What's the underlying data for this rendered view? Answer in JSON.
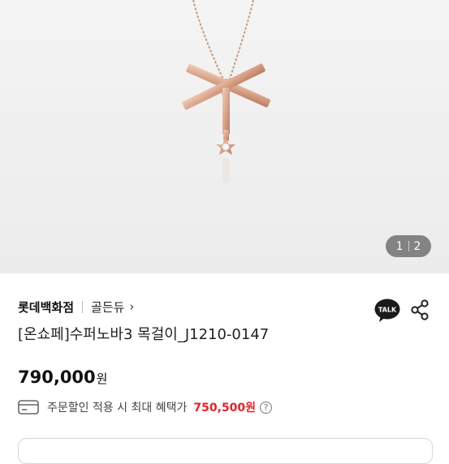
{
  "gallery": {
    "current": "1",
    "total": "2"
  },
  "product": {
    "store": "롯데백화점",
    "brand": "골든듀",
    "brand_chevron": "›",
    "title": "[온쇼페]수퍼노바3 목걸이_J1210-0147",
    "price": "790,000",
    "price_unit": "원"
  },
  "benefit": {
    "label": "주문할인 적용 시 최대 혜택가",
    "price": "750,500원",
    "help": "?"
  },
  "actions": {
    "talk_label": "TALK"
  },
  "colors": {
    "accent_red": "#e4222a",
    "talk_bubble": "#1a1a1a",
    "rose_gold": "#d9a48a"
  },
  "icons": [
    "image-pager",
    "kakao-talk-icon",
    "share-icon",
    "card-icon",
    "help-icon",
    "chevron-right-icon"
  ]
}
